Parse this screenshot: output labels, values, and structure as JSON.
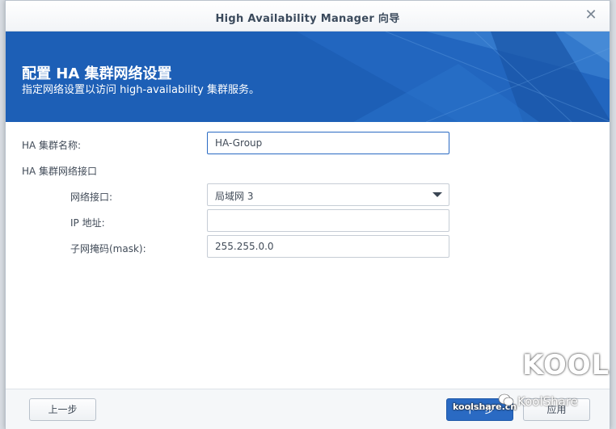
{
  "window": {
    "title": "High Availability Manager 向导",
    "close_glyph": "✕"
  },
  "banner": {
    "heading": "配置 HA 集群网络设置",
    "subheading": "指定网络设置以访问 high-availability 集群服务。"
  },
  "form": {
    "cluster_name_label": "HA 集群名称:",
    "cluster_name_value": "HA-Group",
    "cluster_network_label": "HA 集群网络接口",
    "network_interface_label": "网络接口:",
    "network_interface_value": "局域网 3",
    "ip_label": "IP 地址:",
    "ip_value": "",
    "subnet_label": "子网掩码(mask):",
    "subnet_value": "255.255.0.0"
  },
  "footer": {
    "back_label": "上一步",
    "next_label": "下一步",
    "finish_label": "应用"
  },
  "watermark": {
    "logo_text": "KOOL",
    "sub_text": "KoolShare",
    "small_text": "koolshare.cn"
  },
  "colors": {
    "accent": "#2a6ac3",
    "banner": "#1d5fb6"
  }
}
